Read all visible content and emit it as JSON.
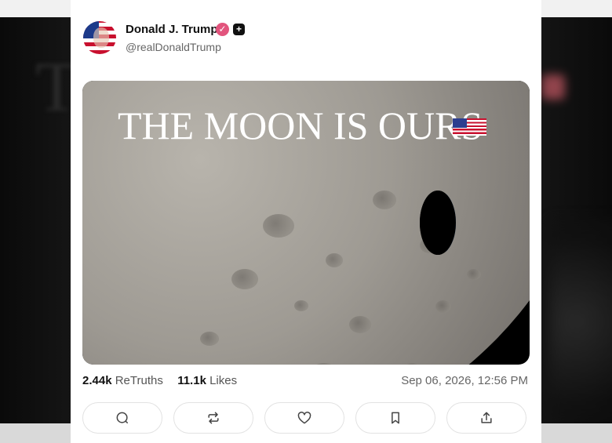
{
  "post": {
    "author_name": "Donald J. Trump",
    "handle": "@realDonaldTrump",
    "verified_icon": "verified-check-icon",
    "badge_icon": "plus-badge-icon",
    "media": {
      "headline": "THE MOON IS OURS",
      "flag_icon": "us-flag-icon"
    },
    "stats": {
      "retruths_count": "2.44k",
      "retruths_label": "ReTruths",
      "likes_count": "11.1k",
      "likes_label": "Likes"
    },
    "timestamp": "Sep 06, 2026, 12:56 PM"
  },
  "actions": [
    {
      "name": "reply",
      "icon": "comment-icon"
    },
    {
      "name": "retruth",
      "icon": "repost-icon"
    },
    {
      "name": "like",
      "icon": "heart-icon"
    },
    {
      "name": "bookmark",
      "icon": "bookmark-icon"
    },
    {
      "name": "share",
      "icon": "share-icon"
    }
  ],
  "colors": {
    "verified": "#e2547d",
    "text_primary": "#111111",
    "text_secondary": "#666666"
  }
}
